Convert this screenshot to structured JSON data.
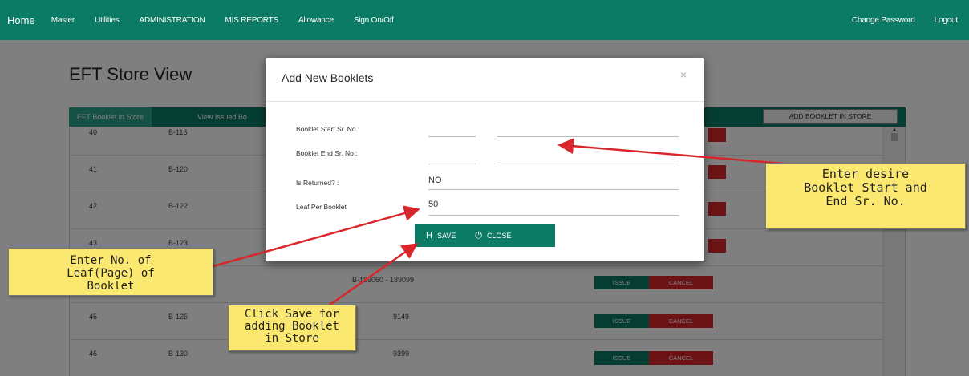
{
  "nav": {
    "home": "Home",
    "items": [
      "Master",
      "Utilities",
      "ADMINISTRATION",
      "MIS REPORTS",
      "Allowance",
      "Sign On/Off"
    ],
    "change_password": "Change Password",
    "logout": "Logout"
  },
  "page": {
    "title": "EFT Store View",
    "tab_active": "EFT Booklet in Store",
    "tab_second": "View Issued Bo",
    "add_booklet_button": "ADD BOOKLET IN STORE"
  },
  "table_rows": [
    {
      "no": "40",
      "booklet": "B-116",
      "range": ""
    },
    {
      "no": "41",
      "booklet": "B-120",
      "range": ""
    },
    {
      "no": "42",
      "booklet": "B-122",
      "range": ""
    },
    {
      "no": "43",
      "booklet": "B-123",
      "range": ""
    },
    {
      "no": "",
      "booklet": "",
      "range": "B-189060 - 189099"
    },
    {
      "no": "45",
      "booklet": "B-125",
      "range": "9149"
    },
    {
      "no": "46",
      "booklet": "B-130",
      "range": "9399"
    }
  ],
  "row_buttons": {
    "issue": "ISSUE",
    "cancel": "CANCEL"
  },
  "modal": {
    "title": "Add New Booklets",
    "close_symbol": "×",
    "fields": {
      "start_label": "Booklet Start Sr. No.:",
      "end_label": "Booklet End Sr. No.:",
      "returned_label": "Is Returned? :",
      "returned_value": "NO",
      "leaf_label": "Leaf Per Booklet",
      "leaf_value": "50"
    },
    "save_label": "SAVE",
    "close_label": "CLOSE"
  },
  "callouts": {
    "leaf": [
      "Enter No. of",
      "Leaf(Page) of",
      "Booklet"
    ],
    "booklet": [
      "Enter desire",
      "Booklet Start and",
      "End Sr. No."
    ],
    "save": [
      "Click Save for",
      "adding Booklet",
      "in Store"
    ]
  },
  "colors": {
    "nav_green": "#0c7b65",
    "tab_active": "#2aa389",
    "cancel_red": "#d9262a",
    "callout_yellow": "#fbe870",
    "arrow_red": "#d9262a"
  }
}
